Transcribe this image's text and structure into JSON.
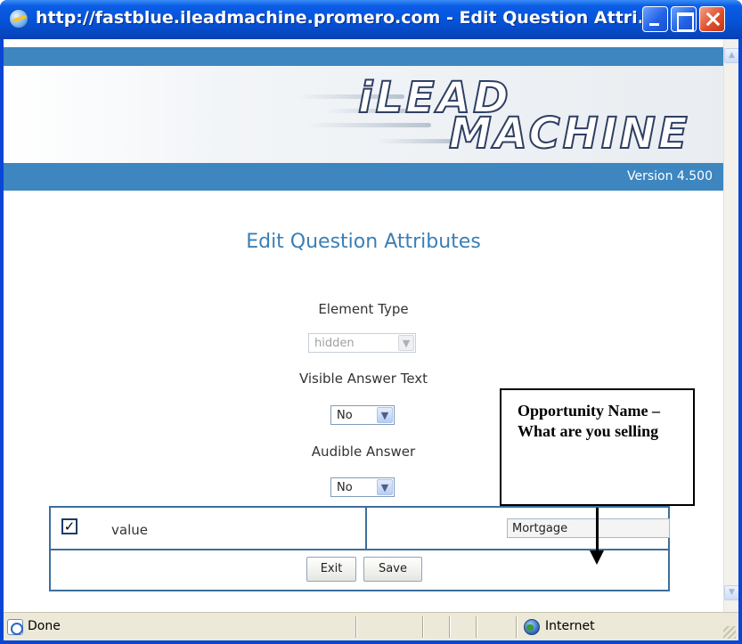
{
  "window": {
    "title": "http://fastblue.ileadmachine.promero.com - Edit Question Attri..."
  },
  "banner": {
    "logo_line1": "iLEAD",
    "logo_line2": "MACHINE",
    "version": "Version 4.500"
  },
  "form": {
    "title": "Edit Question Attributes",
    "element_type": {
      "label": "Element Type",
      "value": "hidden",
      "disabled": true
    },
    "visible_answer_text": {
      "label": "Visible Answer Text",
      "value": "No"
    },
    "audible_answer": {
      "label": "Audible Answer",
      "value": "No"
    },
    "row": {
      "checked": true,
      "label": "value",
      "input_value": "Mortgage"
    },
    "buttons": {
      "exit": "Exit",
      "save": "Save"
    }
  },
  "annotation": {
    "callout_text": "Opportunity Name – What are you selling"
  },
  "statusbar": {
    "status": "Done",
    "zone": "Internet"
  },
  "colors": {
    "brand_blue": "#3d86c0",
    "title_blue": "#3a7fb6",
    "xp_titlebar": "#0553d8"
  }
}
